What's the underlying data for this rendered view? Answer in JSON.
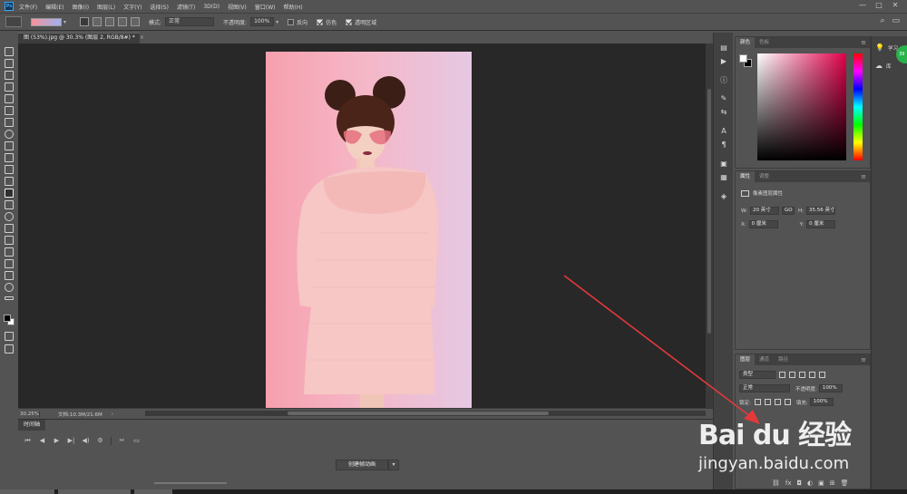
{
  "app": {
    "logo": "Ps",
    "menu": [
      "文件(F)",
      "编辑(E)",
      "图像(I)",
      "图层(L)",
      "文字(Y)",
      "选择(S)",
      "滤镜(T)",
      "3D(D)",
      "视图(V)",
      "窗口(W)",
      "帮助(H)"
    ],
    "window_controls": [
      "—",
      "□",
      "✕"
    ]
  },
  "options": {
    "mode_label": "模式:",
    "mode_value": "正常",
    "opacity_label": "不透明度:",
    "opacity_value": "100%",
    "reverse_label": "反向",
    "dither_label": "仿色",
    "transparency_label": "透明区域",
    "reverse_checked": false,
    "dither_checked": true,
    "transparency_checked": true,
    "gradient_colors": [
      "#f5939c",
      "#9eb1f0"
    ]
  },
  "document": {
    "tab_title": "图 (53%).jpg @ 30.3% (图层 2, RGB/8#) *",
    "zoom": "30.25%",
    "doc_size": "文档:10.3M/21.6M"
  },
  "timeline": {
    "tab_label": "时间轴",
    "create_button": "创建帧动画",
    "controls": [
      "⏮",
      "◀",
      "▶",
      "▶|",
      "◀)",
      "⚙",
      "✂",
      "▭"
    ]
  },
  "color_panel": {
    "tabs": [
      "颜色",
      "色板"
    ],
    "foreground": "#ffffff",
    "background": "#000000"
  },
  "properties_panel": {
    "tabs": [
      "属性",
      "调整"
    ],
    "section": "像素图层属性",
    "w_label": "W:",
    "w_value": "20 英寸",
    "link": "GO",
    "h_label": "H:",
    "h_value": "35.56 英寸",
    "x_label": "X:",
    "x_value": "0 厘米",
    "y_label": "Y:",
    "y_value": "0 厘米"
  },
  "layers_panel": {
    "tabs": [
      "图层",
      "通道",
      "路径"
    ],
    "filter_type": "类型",
    "blend_mode": "正常",
    "opacity_label": "不透明度:",
    "opacity_value": "100%",
    "lock_label": "锁定:",
    "fill_label": "填充:",
    "fill_value": "100%",
    "footer_icons": [
      "⛓",
      "fx",
      "◘",
      "◐",
      "▣",
      "⊞",
      "🗑"
    ]
  },
  "learn": {
    "learn_label": "学习",
    "library_label": "库",
    "badge": "39"
  },
  "watermark": {
    "main": "Bai du 经验",
    "url": "jingyan.baidu.com"
  },
  "accent": {
    "arrow": "#e3393b",
    "canvas_bg": "#282828",
    "ui_bg": "#535353"
  }
}
